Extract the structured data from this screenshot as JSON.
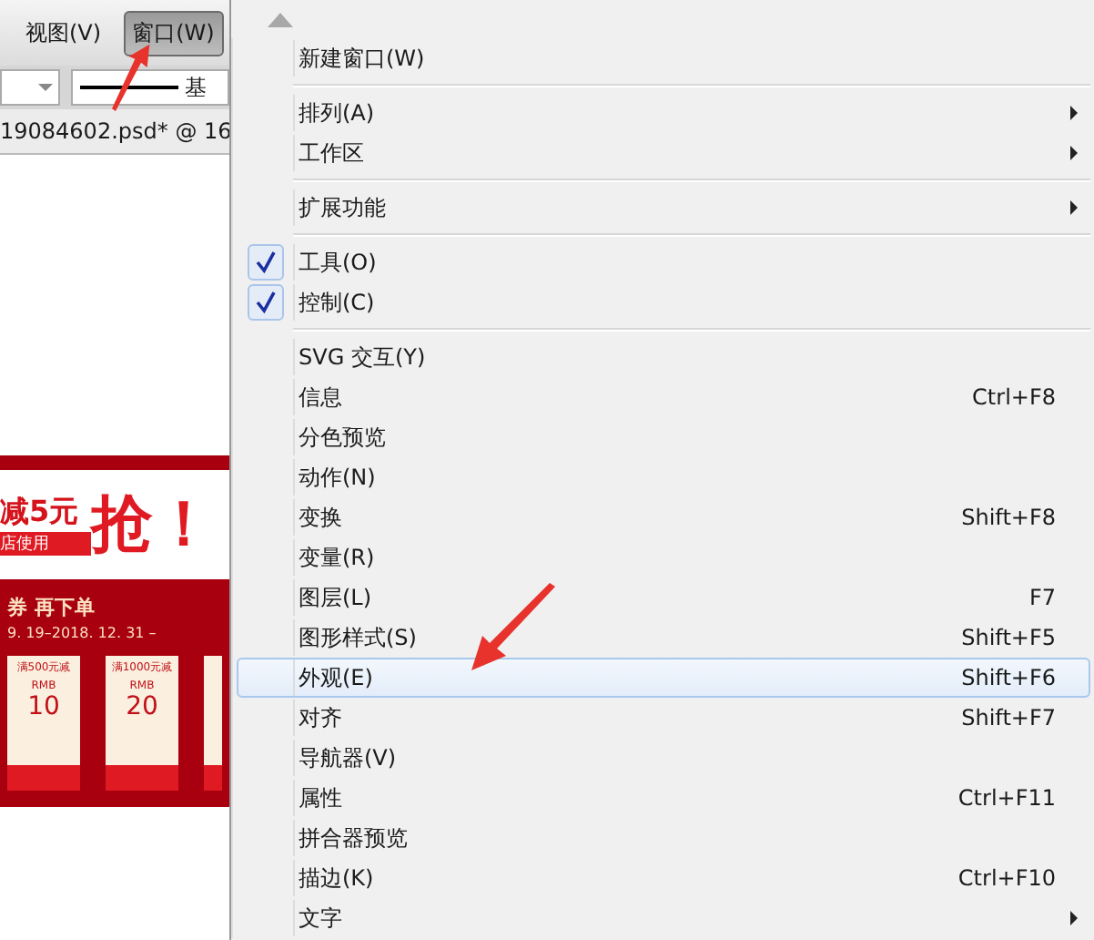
{
  "menubar": [
    {
      "label": "视图(V)",
      "selected": false
    },
    {
      "label": "窗口(W)",
      "selected": true
    }
  ],
  "toolbar": {
    "stroke_label": "基"
  },
  "document": {
    "tab": "19084602.psd* @ 16",
    "banner": {
      "discount": "减5元",
      "note": "店使用",
      "grab": "抢！",
      "coupon_title": "券  再下单",
      "dates": "9. 19–2018. 12. 31 –",
      "coupons": [
        {
          "condition": "满500元减",
          "currency": "RMB",
          "amount": "10"
        },
        {
          "condition": "满1000元减",
          "currency": "RMB",
          "amount": "20"
        }
      ]
    }
  },
  "menu": [
    {
      "kind": "item",
      "label": "新建窗口(W)",
      "checked": false,
      "submenu": false,
      "selected": false
    },
    {
      "kind": "separator"
    },
    {
      "kind": "item",
      "label": "排列(A)",
      "checked": false,
      "submenu": true,
      "selected": false
    },
    {
      "kind": "item",
      "label": "工作区",
      "checked": false,
      "submenu": true,
      "selected": false
    },
    {
      "kind": "separator"
    },
    {
      "kind": "item",
      "label": "扩展功能",
      "checked": false,
      "submenu": true,
      "selected": false
    },
    {
      "kind": "separator"
    },
    {
      "kind": "item",
      "label": "工具(O)",
      "checked": true,
      "submenu": false,
      "selected": false
    },
    {
      "kind": "item",
      "label": "控制(C)",
      "checked": true,
      "submenu": false,
      "selected": false
    },
    {
      "kind": "separator"
    },
    {
      "kind": "item",
      "label": "SVG 交互(Y)",
      "checked": false,
      "submenu": false,
      "selected": false
    },
    {
      "kind": "item",
      "label": "信息",
      "shortcut": "Ctrl+F8",
      "checked": false,
      "submenu": false,
      "selected": false
    },
    {
      "kind": "item",
      "label": "分色预览",
      "checked": false,
      "submenu": false,
      "selected": false
    },
    {
      "kind": "item",
      "label": "动作(N)",
      "checked": false,
      "submenu": false,
      "selected": false
    },
    {
      "kind": "item",
      "label": "变换",
      "shortcut": "Shift+F8",
      "checked": false,
      "submenu": false,
      "selected": false
    },
    {
      "kind": "item",
      "label": "变量(R)",
      "checked": false,
      "submenu": false,
      "selected": false
    },
    {
      "kind": "item",
      "label": "图层(L)",
      "shortcut": "F7",
      "checked": false,
      "submenu": false,
      "selected": false
    },
    {
      "kind": "item",
      "label": "图形样式(S)",
      "shortcut": "Shift+F5",
      "checked": false,
      "submenu": false,
      "selected": false
    },
    {
      "kind": "item",
      "label": "外观(E)",
      "shortcut": "Shift+F6",
      "checked": false,
      "submenu": false,
      "selected": true
    },
    {
      "kind": "item",
      "label": "对齐",
      "shortcut": "Shift+F7",
      "checked": false,
      "submenu": false,
      "selected": false
    },
    {
      "kind": "item",
      "label": "导航器(V)",
      "checked": false,
      "submenu": false,
      "selected": false
    },
    {
      "kind": "item",
      "label": "属性",
      "shortcut": "Ctrl+F11",
      "checked": false,
      "submenu": false,
      "selected": false
    },
    {
      "kind": "item",
      "label": "拼合器预览",
      "checked": false,
      "submenu": false,
      "selected": false
    },
    {
      "kind": "item",
      "label": "描边(K)",
      "shortcut": "Ctrl+F10",
      "checked": false,
      "submenu": false,
      "selected": false
    },
    {
      "kind": "item",
      "label": "文字",
      "checked": false,
      "submenu": true,
      "selected": false
    }
  ]
}
